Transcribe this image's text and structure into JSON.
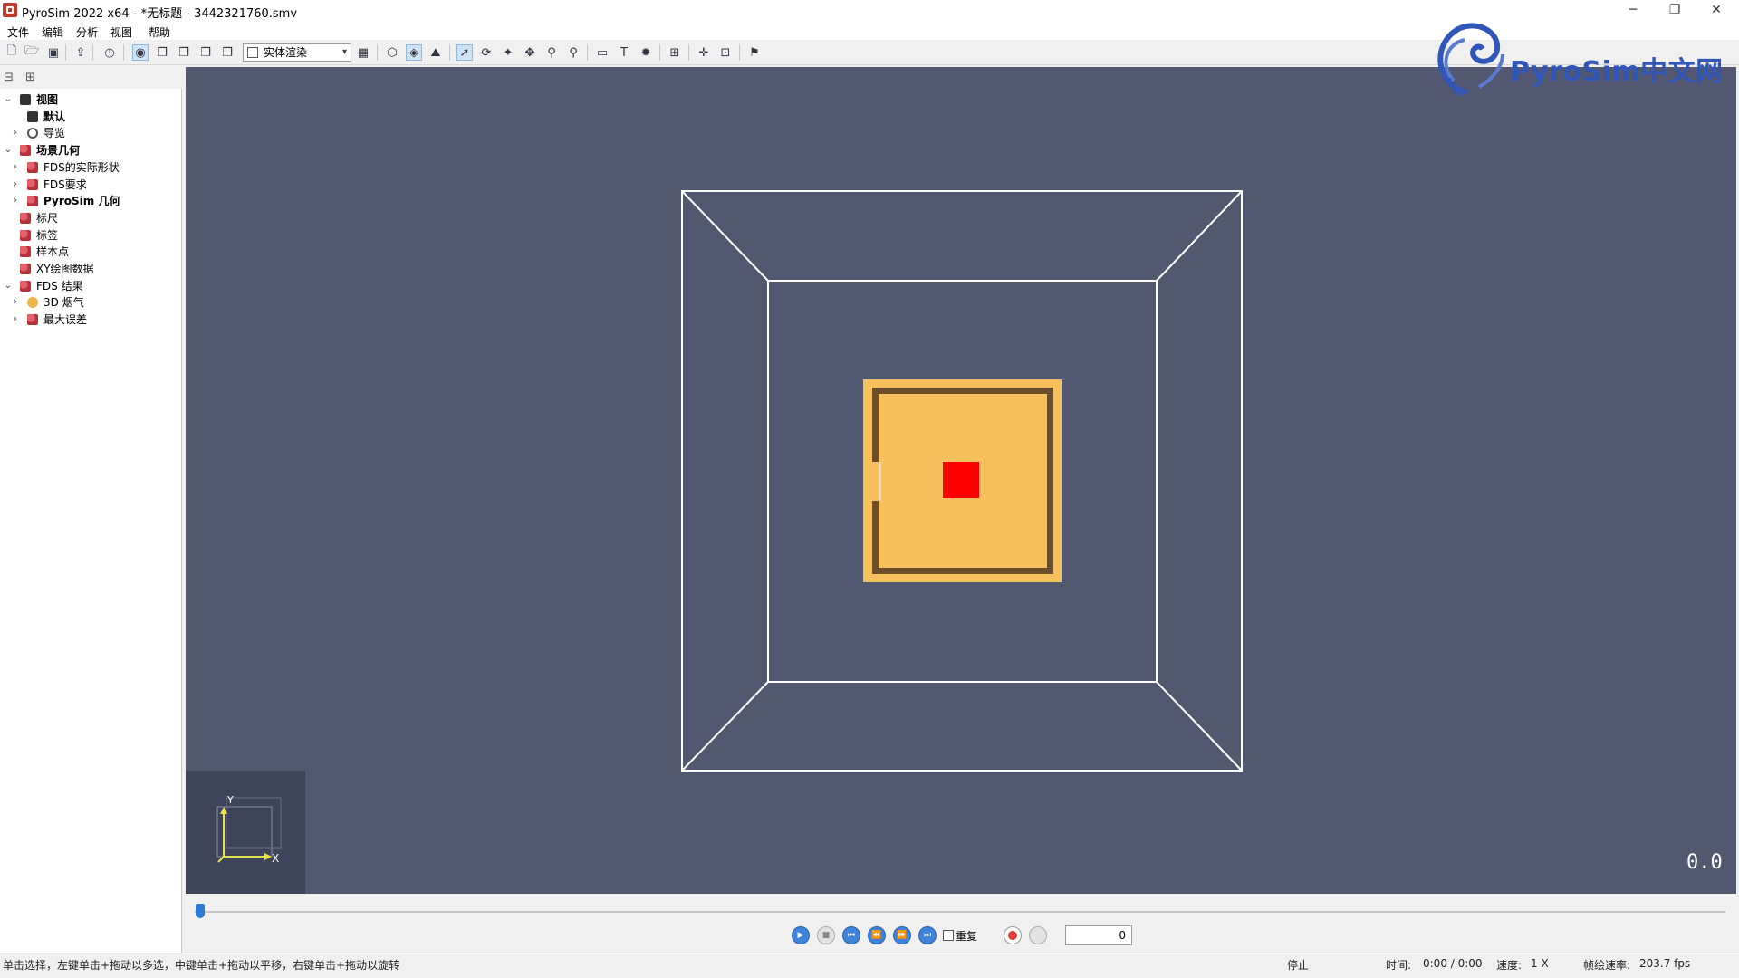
{
  "window": {
    "title": "PyroSim 2022 x64 - *无标题 - 3442321760.smv",
    "minimize_glyph": "─",
    "restore_glyph": "❐",
    "close_glyph": "✕"
  },
  "menu": [
    "文件",
    "编辑",
    "分析",
    "视图",
    "帮助"
  ],
  "toolbar": {
    "render_mode": "实体渲染",
    "icons": [
      "new-file-icon",
      "open-folder-icon",
      "save-icon",
      "export-icon",
      "clock-icon",
      "render-icon",
      "copy-icon",
      "window-icon",
      "window-icon",
      "window-icon",
      "grid-icon",
      "mesh-icon",
      "wireframe-icon",
      "terrain-icon",
      "select-arrow-icon",
      "rotate-icon",
      "walk-icon",
      "pan-icon",
      "zoom-icon",
      "zoom-box-icon",
      "ruler-icon",
      "text-icon",
      "settings-icon",
      "measure-icon",
      "crosshair-icon",
      "fit-icon",
      "flag-icon"
    ]
  },
  "tree": {
    "collapse_glyph": "⊟",
    "expand_glyph": "⊞",
    "items": [
      {
        "label": "视图",
        "level": 0,
        "toggle": "open",
        "icon": "view-icon",
        "bold": true
      },
      {
        "label": "默认",
        "level": 1,
        "toggle": "none",
        "icon": "camera-icon",
        "bold": true
      },
      {
        "label": "导览",
        "level": 1,
        "toggle": "closed",
        "icon": "navigation-icon",
        "bold": false
      },
      {
        "label": "场景几何",
        "level": 0,
        "toggle": "open",
        "icon": "geometry-icon",
        "bold": true
      },
      {
        "label": "FDS的实际形状",
        "level": 1,
        "toggle": "closed",
        "icon": "geometry-icon",
        "bold": false
      },
      {
        "label": "FDS要求",
        "level": 1,
        "toggle": "closed",
        "icon": "geometry-icon",
        "bold": false
      },
      {
        "label": "PyroSim 几何",
        "level": 1,
        "toggle": "closed",
        "icon": "geometry-icon",
        "bold": true
      },
      {
        "label": "标尺",
        "level": 0,
        "toggle": "none",
        "icon": "geometry-icon",
        "bold": false
      },
      {
        "label": "标签",
        "level": 0,
        "toggle": "none",
        "icon": "geometry-icon",
        "bold": false
      },
      {
        "label": "样本点",
        "level": 0,
        "toggle": "none",
        "icon": "geometry-icon",
        "bold": false
      },
      {
        "label": "XY绘图数据",
        "level": 0,
        "toggle": "none",
        "icon": "geometry-icon",
        "bold": false
      },
      {
        "label": "FDS 结果",
        "level": 0,
        "toggle": "open",
        "icon": "geometry-icon",
        "bold": false
      },
      {
        "label": "3D 烟气",
        "level": 1,
        "toggle": "closed",
        "icon": "smoke-icon",
        "bold": false
      },
      {
        "label": "最大误差",
        "level": 1,
        "toggle": "closed",
        "icon": "geometry-icon",
        "bold": false
      }
    ]
  },
  "viewport": {
    "background": "#525870",
    "logo_text": "PyroSim中文网",
    "axis_y": "Y",
    "axis_x": "X",
    "time_overlay": "0.0",
    "colors": {
      "floor": "#f7c05c",
      "wall": "#6b4f2a",
      "fire": "#ff0000",
      "frame": "#ffffff"
    }
  },
  "playback": {
    "buttons": [
      "play",
      "stop",
      "skip-start",
      "rewind",
      "fast-forward",
      "skip-end"
    ],
    "repeat_label": "重复",
    "frame_value": "0",
    "progress": 0
  },
  "status": {
    "hint": "单击选择，左键单击+拖动以多选，中键单击+拖动以平移，右键单击+拖动以旋转",
    "state": "停止",
    "time_label": "时间:",
    "time_value": "0:00 / 0:00",
    "speed_label": "速度:",
    "speed_value": "1 X",
    "fps_label": "帧绘速率:",
    "fps_value": "203.7 fps"
  }
}
